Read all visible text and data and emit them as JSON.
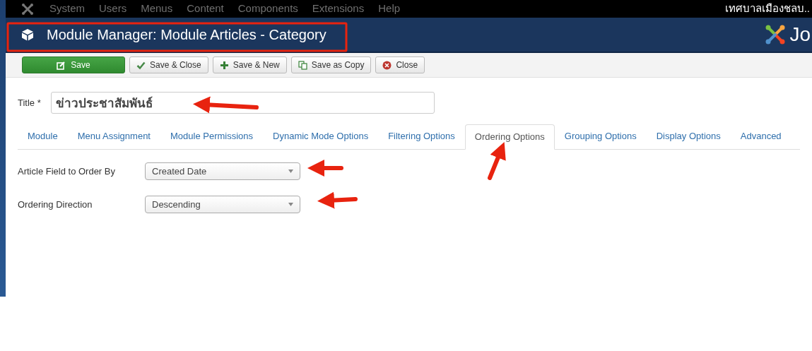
{
  "menu_bar": {
    "items": [
      "System",
      "Users",
      "Menus",
      "Content",
      "Components",
      "Extensions",
      "Help"
    ],
    "user": "เทศบาลเมืองชลบ.."
  },
  "header": {
    "title": "Module Manager: Module Articles - Category",
    "logo_text": "Jo"
  },
  "toolbar": [
    {
      "label": "Save",
      "kind": "edit",
      "primary": true
    },
    {
      "label": "Save & Close",
      "kind": "check",
      "primary": false
    },
    {
      "label": "Save & New",
      "kind": "plus",
      "primary": false
    },
    {
      "label": "Save as Copy",
      "kind": "copy",
      "primary": false
    },
    {
      "label": "Close",
      "kind": "close",
      "primary": false
    }
  ],
  "title_field": {
    "label": "Title *",
    "value": "ข่าวประชาสัมพันธ์"
  },
  "tabs": [
    {
      "label": "Module",
      "selected": false
    },
    {
      "label": "Menu Assignment",
      "selected": false
    },
    {
      "label": "Module Permissions",
      "selected": false
    },
    {
      "label": "Dynamic Mode Options",
      "selected": false
    },
    {
      "label": "Filtering Options",
      "selected": false
    },
    {
      "label": "Ordering Options",
      "selected": true
    },
    {
      "label": "Grouping Options",
      "selected": false
    },
    {
      "label": "Display Options",
      "selected": false
    },
    {
      "label": "Advanced",
      "selected": false
    }
  ],
  "fields": [
    {
      "label": "Article Field to Order By",
      "value": "Created Date"
    },
    {
      "label": "Ordering Direction",
      "value": "Descending"
    }
  ]
}
